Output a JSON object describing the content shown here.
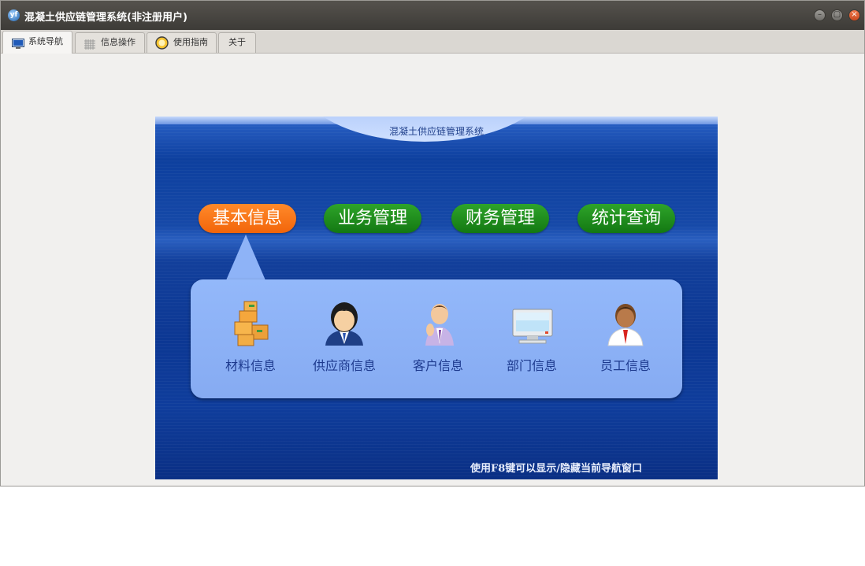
{
  "window": {
    "title": "混凝土供应链管理系统(非注册用户)",
    "app_icon": "yf"
  },
  "window_controls": {
    "minimize": "–",
    "maximize": "▢",
    "close": "×"
  },
  "tabs": [
    {
      "label": "系统导航",
      "icon": "monitor-icon"
    },
    {
      "label": "信息操作",
      "icon": "grid-icon"
    },
    {
      "label": "使用指南",
      "icon": "help-icon"
    },
    {
      "label": "关于",
      "icon": ""
    }
  ],
  "nav": {
    "header_title": "混凝土供应链管理系统",
    "categories": [
      {
        "label": "基本信息",
        "active": true
      },
      {
        "label": "业务管理",
        "active": false
      },
      {
        "label": "财务管理",
        "active": false
      },
      {
        "label": "统计查询",
        "active": false
      }
    ],
    "sub_items": [
      {
        "label": "材料信息",
        "icon": "boxes-icon"
      },
      {
        "label": "供应商信息",
        "icon": "supplier-person-icon"
      },
      {
        "label": "客户信息",
        "icon": "customer-person-icon"
      },
      {
        "label": "部门信息",
        "icon": "computer-monitor-icon"
      },
      {
        "label": "员工信息",
        "icon": "employee-person-icon"
      }
    ],
    "hint": "使用F8键可以显示/隐藏当前导航窗口"
  },
  "colors": {
    "active_category": "#f2650a",
    "category": "#137812",
    "panel_blue": "#0d3f9e",
    "sub_panel": "#8eb3f7"
  }
}
